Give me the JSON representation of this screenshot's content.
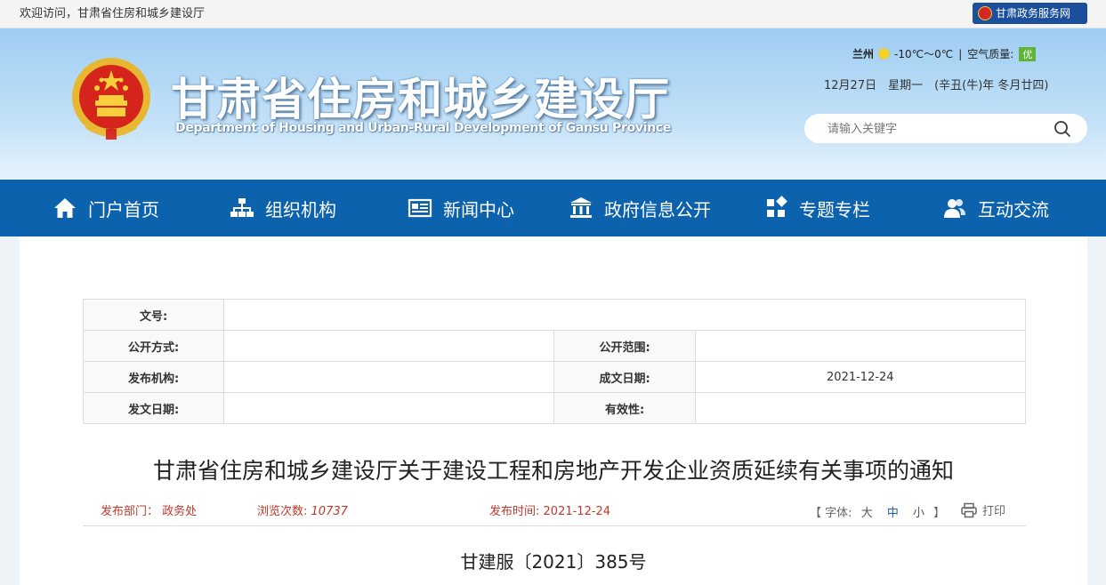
{
  "topbar": {
    "welcome": "欢迎访问，甘肃省住房和城乡建设厅",
    "gov_service": "甘肃政务服务网"
  },
  "header": {
    "title": "甘肃省住房和城乡建设厅",
    "subtitle": "Department of Housing and Urban-Rural Development of Gansu Province",
    "weather": {
      "city": "兰州",
      "temp": "-10℃～0℃",
      "separator": "|",
      "aqi_label": "空气质量:",
      "aqi_value": "优"
    },
    "date": "12月27日　星期一　(辛丑(牛)年 冬月廿四)",
    "search_placeholder": "请输入关键字"
  },
  "nav": [
    {
      "label": "门户首页",
      "icon": "home-icon"
    },
    {
      "label": "组织机构",
      "icon": "org-chart-icon"
    },
    {
      "label": "新闻中心",
      "icon": "newspaper-icon"
    },
    {
      "label": "政府信息公开",
      "icon": "government-building-icon"
    },
    {
      "label": "专题专栏",
      "icon": "grid-squares-icon"
    },
    {
      "label": "互动交流",
      "icon": "users-icon"
    }
  ],
  "meta_table": {
    "doc_no_label": "文号:",
    "doc_no_value": "",
    "open_method_label": "公开方式:",
    "open_method_value": "",
    "open_scope_label": "公开范围:",
    "open_scope_value": "",
    "publisher_label": "发布机构:",
    "publisher_value": "",
    "created_label": "成文日期:",
    "created_value": "2021-12-24",
    "issued_label": "发文日期:",
    "issued_value": "",
    "validity_label": "有效性:",
    "validity_value": ""
  },
  "article": {
    "title": "甘肃省住房和城乡建设厅关于建设工程和房地产开发企业资质延续有关事项的通知",
    "dept_label": "发布部门：",
    "dept_value": "政务处",
    "views_label": "浏览次数:",
    "views_value": "10737",
    "time_label": "发布时间:",
    "time_value": "2021-12-24",
    "font_open": "【",
    "font_label": "字体:",
    "font_large": "大",
    "font_medium": "中",
    "font_small": "小",
    "font_close": "】",
    "print_label": "打印",
    "doc_number": "甘建服〔2021〕385号"
  }
}
